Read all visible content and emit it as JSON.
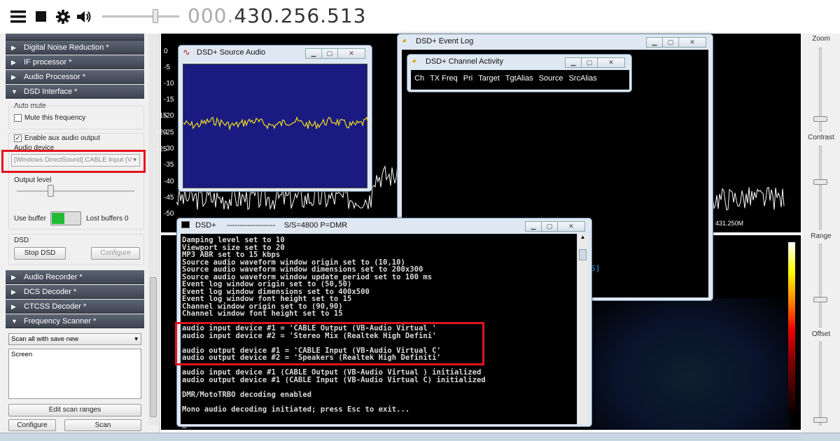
{
  "toolbar": {
    "menu_icon": "hamburger-icon",
    "stop_icon": "stop-icon",
    "settings_icon": "gear-icon",
    "volume_icon": "speaker-icon",
    "frequency_dim": "000.",
    "frequency": "430.256.513"
  },
  "left_panel": {
    "sections_top": [
      "Digital Noise Reduction *",
      "IF processor *",
      "Audio Processor *",
      "DSD Interface *"
    ],
    "auto_mute_label": "Auto mute",
    "mute_freq_label": "Mute this frequency",
    "enable_aux_label": "Enable aux audio output",
    "audio_device_label": "Audio device",
    "audio_device_value": "[Windows DirectSound] CABLE Input (V",
    "output_level_label": "Output level",
    "use_buffer_label": "Use buffer",
    "lost_buffers_label": "Lost buffers 0",
    "dsd_label": "DSD",
    "stop_dsd_label": "Stop DSD",
    "configure_label": "Configure",
    "sections_bottom": [
      "Audio Recorder *",
      "DCS Decoder *",
      "CTCSS Decoder *",
      "Frequency Scanner *"
    ],
    "scan_mode_value": "Scan all with save new",
    "screen_label": "Screen",
    "edit_scan_label": "Edit scan ranges",
    "configure2_label": "Configure",
    "scan_label": "Scan"
  },
  "spectrum": {
    "y_ticks": [
      "0",
      "-5",
      "-10",
      "-15",
      "-20",
      "-25",
      "-30",
      "-35",
      "-40",
      "-45",
      "-50"
    ],
    "freq_label": "431.250M"
  },
  "right_panel": {
    "zoom_label": "Zoom",
    "contrast_label": "Contrast",
    "range_label": "Range",
    "offset_label": "Offset"
  },
  "windows": {
    "source_audio_title": "DSD+ Source Audio",
    "source_audio_ticks": [
      "-15",
      "-20",
      "-25"
    ],
    "event_log_title": "DSD+ Event Log",
    "channel_activity_title": "DSD+ Channel Activity",
    "channel_columns": [
      "Ch",
      "TX Freq",
      "Pri",
      "Target",
      "TgtAlias",
      "Source",
      "SrcAlias"
    ],
    "event_log_overflow": "5]",
    "console_title": "DSD+     -------------------    S/S=4800 P=DMR",
    "console_lines": [
      "Damping level set to 10",
      "Viewport size set to 20",
      "MP3 ABR set to 15 kbps",
      "Source audio waveform window origin set to (10,10)",
      "Source audio waveform window dimensions set to 200x300",
      "Source audio waveform window update period set to 100 ms",
      "Event log window origin set to (50,50)",
      "Event log window dimensions set to 400x500",
      "Event log window font height set to 15",
      "Channel window origin set to (90,90)",
      "Channel window font height set to 15",
      "",
      "audio input device #1 = 'CABLE Output (VB-Audio Virtual '",
      "audio input device #2 = 'Stereo Mix (Realtek High Defini'",
      "",
      "audio output device #1 = 'CABLE Input (VB-Audio Virtual C'",
      "audio output device #2 = 'Speakers (Realtek High Definiti'",
      "",
      "audio input device #1 (CABLE Output (VB-Audio Virtual ) initialized",
      "audio output device #1 (CABLE Input (VB-Audio Virtual C) initialized",
      "",
      "DMR/MotoTRBO decoding enabled",
      "",
      "Mono audio decoding initiated; press Esc to exit...",
      "",
      "_"
    ]
  },
  "colors": {
    "highlight": "#e3141c",
    "waveform": "#f0e020",
    "source_bg": "#1a1a80",
    "toggle_on": "#22bb33"
  }
}
